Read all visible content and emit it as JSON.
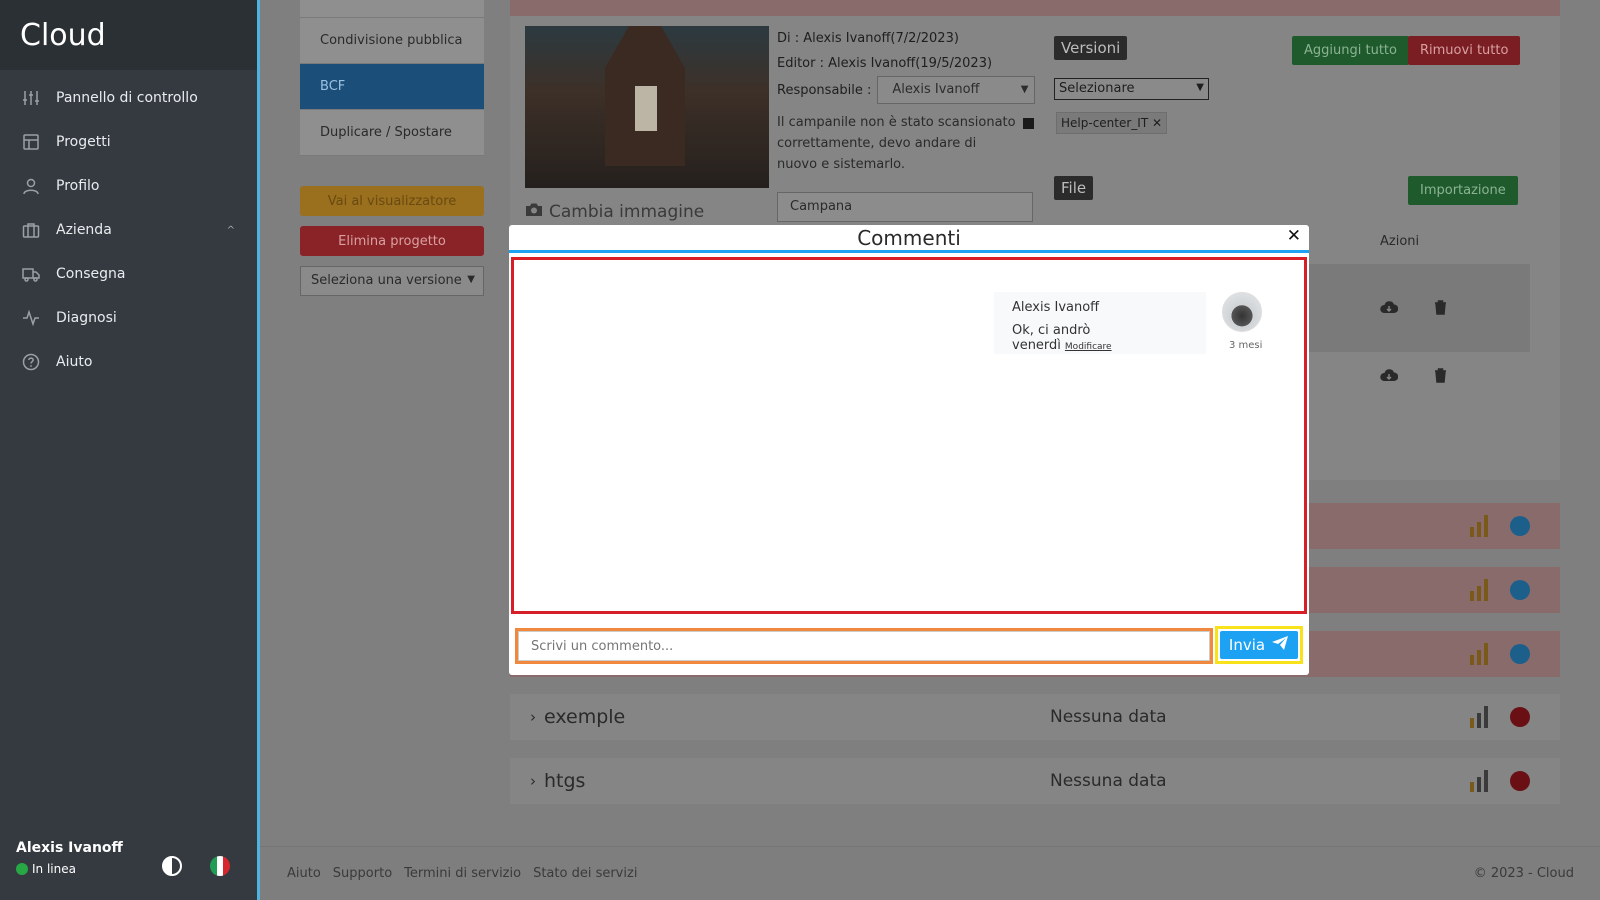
{
  "brand": "Cloud",
  "nav": [
    {
      "label": "Pannello di controllo",
      "icon": "sliders-icon"
    },
    {
      "label": "Progetti",
      "icon": "layout-icon"
    },
    {
      "label": "Profilo",
      "icon": "user-icon"
    },
    {
      "label": "Azienda",
      "icon": "briefcase-icon"
    },
    {
      "label": "Consegna",
      "icon": "truck-icon"
    },
    {
      "label": "Diagnosi",
      "icon": "activity-icon"
    },
    {
      "label": "Aiuto",
      "icon": "help-circle-icon"
    }
  ],
  "user": {
    "name": "Alexis Ivanoff",
    "status": "In linea"
  },
  "project_tabs": [
    "Condivisione pubblica",
    "BCF",
    "Duplicare / Spostare"
  ],
  "project_actions": {
    "viewer": "Vai al visualizzatore",
    "delete": "Elimina progetto",
    "version_select": "Seleziona una versione"
  },
  "detail": {
    "change_image": "Cambia immagine",
    "by": "Di : Alexis Ivanoff(7/2/2023)",
    "editor": "Editor : Alexis Ivanoff(19/5/2023)",
    "responsible_label": "Responsabile :",
    "responsible_value": "Alexis Ivanoff",
    "description": "Il campanile non è stato scansionato correttamente, devo andare di nuovo e sistemarlo.",
    "name_value": "Campana",
    "versions_label": "Versioni",
    "add_all": "Aggiungi tutto",
    "remove_all": "Rimuovi tutto",
    "versions_select": "Selezionare",
    "tag": "Help-center_IT",
    "file_label": "File",
    "import": "Importazione",
    "actions_header": "Azioni"
  },
  "rows": [
    {
      "title": "exemple",
      "date": "Nessuna data"
    },
    {
      "title": "htgs",
      "date": "Nessuna data"
    }
  ],
  "footer": {
    "links": [
      "Aiuto",
      "Supporto",
      "Termini di servizio",
      "Stato dei servizi"
    ],
    "copyright": "© 2023 - Cloud"
  },
  "modal": {
    "title": "Commenti",
    "comment_author": "Alexis Ivanoff",
    "comment_text": "Ok, ci andrò venerdì",
    "comment_edit": "Modificare",
    "comment_time": "3 mesi",
    "input_placeholder": "Scrivi un commento...",
    "send_label": "Invia"
  },
  "colors": {
    "accent": "#1da1f2",
    "danger": "#d61f26",
    "sidebar": "#343a40"
  }
}
